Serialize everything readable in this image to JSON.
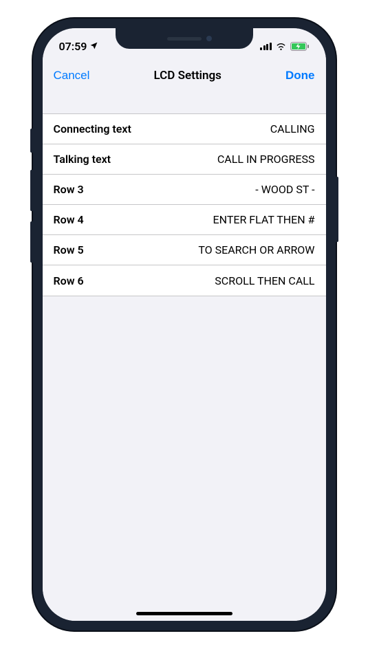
{
  "status_bar": {
    "time": "07:59"
  },
  "nav": {
    "cancel": "Cancel",
    "title": "LCD Settings",
    "done": "Done"
  },
  "rows": [
    {
      "label": "Connecting text",
      "value": "CALLING"
    },
    {
      "label": "Talking text",
      "value": "CALL IN PROGRESS"
    },
    {
      "label": "Row 3",
      "value": "- WOOD ST -"
    },
    {
      "label": "Row 4",
      "value": "ENTER FLAT THEN #"
    },
    {
      "label": "Row 5",
      "value": "TO SEARCH OR ARROW"
    },
    {
      "label": "Row 6",
      "value": "SCROLL THEN CALL"
    }
  ]
}
